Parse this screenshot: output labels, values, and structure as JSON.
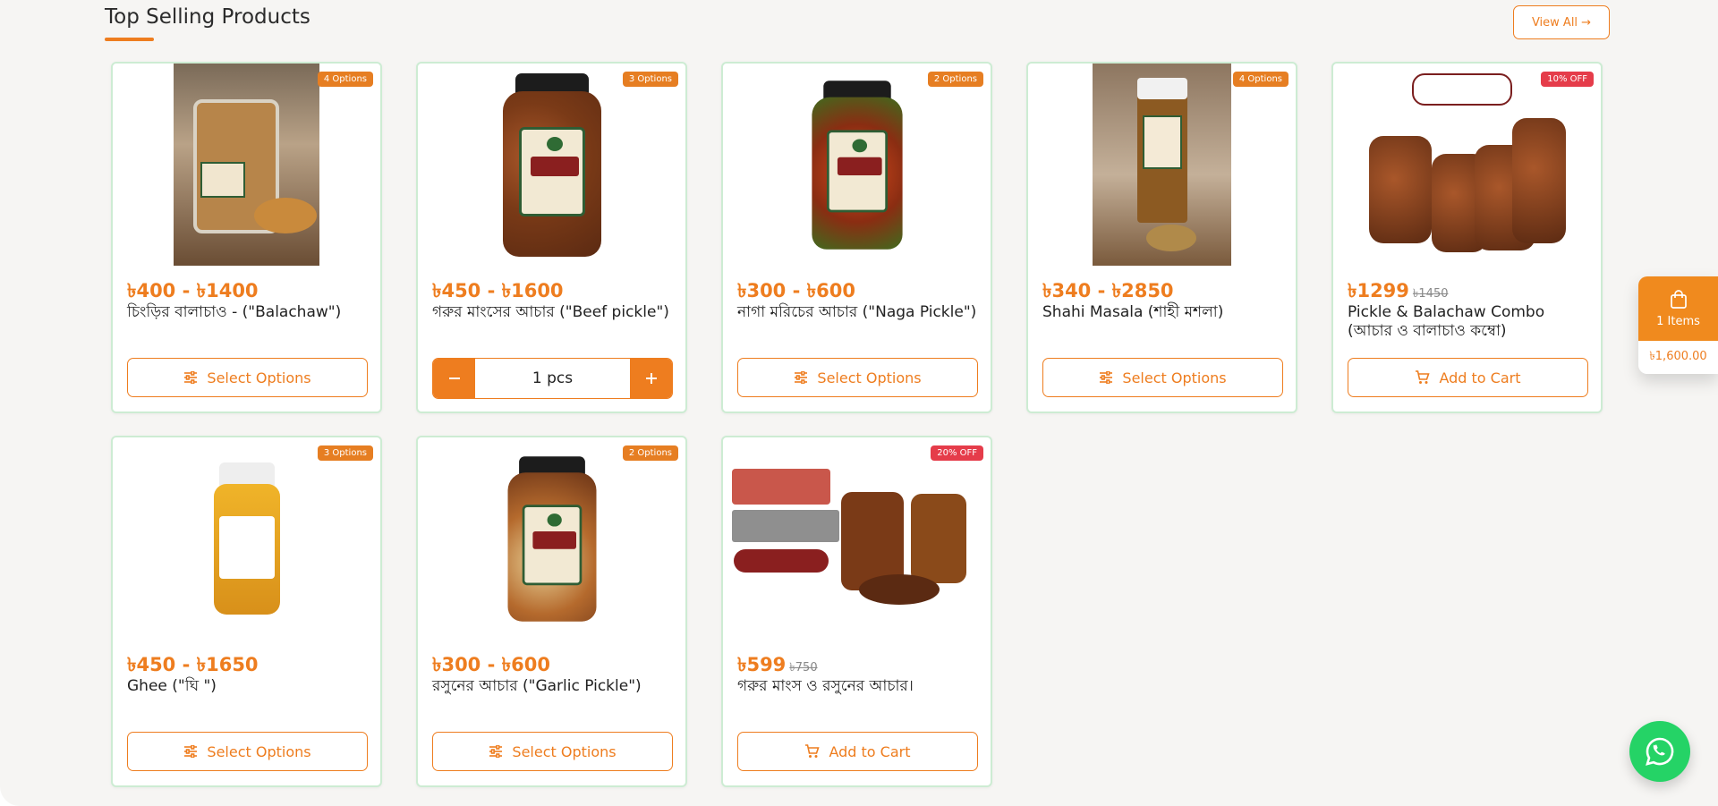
{
  "section": {
    "title": "Top Selling Products",
    "view_all_label": "View All →"
  },
  "products": [
    {
      "badge": "4 Options",
      "price": "৳400 - ৳1400",
      "name": "চিংড়ির বালাচাও - (\"Balachaw\")",
      "action": "Select Options"
    },
    {
      "badge": "3 Options",
      "price": "৳450 - ৳1600",
      "name": "গরুর মাংসের আচার (\"Beef pickle\")",
      "quantity": "1 pcs"
    },
    {
      "badge": "2 Options",
      "price": "৳300 - ৳600",
      "name": "নাগা মরিচের আচার (\"Naga Pickle\")",
      "action": "Select Options"
    },
    {
      "badge": "4 Options",
      "price": "৳340 - ৳2850",
      "name": "Shahi Masala (শাহী মশলা)",
      "action": "Select Options"
    },
    {
      "badge": "10% OFF",
      "price": "৳1299",
      "old_price": "৳1450",
      "name": "Pickle & Balachaw Combo (আচার ও বালাচাও কম্বো)",
      "action": "Add to Cart"
    },
    {
      "badge": "3 Options",
      "price": "৳450 - ৳1650",
      "name": "Ghee (\"ঘি \")",
      "action": "Select Options"
    },
    {
      "badge": "2 Options",
      "price": "৳300 - ৳600",
      "name": "রসুনের আচার (\"Garlic Pickle\")",
      "action": "Select Options"
    },
    {
      "badge": "20% OFF",
      "price": "৳599",
      "old_price": "৳750",
      "name": "গরুর মাংস ও রসুনের আচার।",
      "action": "Add to Cart"
    }
  ],
  "mini_cart": {
    "items_label": "1 Items",
    "total": "৳1,600.00"
  },
  "colors": {
    "accent": "#ee7d1f",
    "discount_badge": "#e53c4a",
    "card_border": "#cdecd3",
    "whatsapp": "#25d366"
  },
  "icons": [
    "sliders-icon",
    "cart-icon",
    "shopping-bag-icon",
    "whatsapp-icon",
    "minus-icon",
    "plus-icon"
  ]
}
